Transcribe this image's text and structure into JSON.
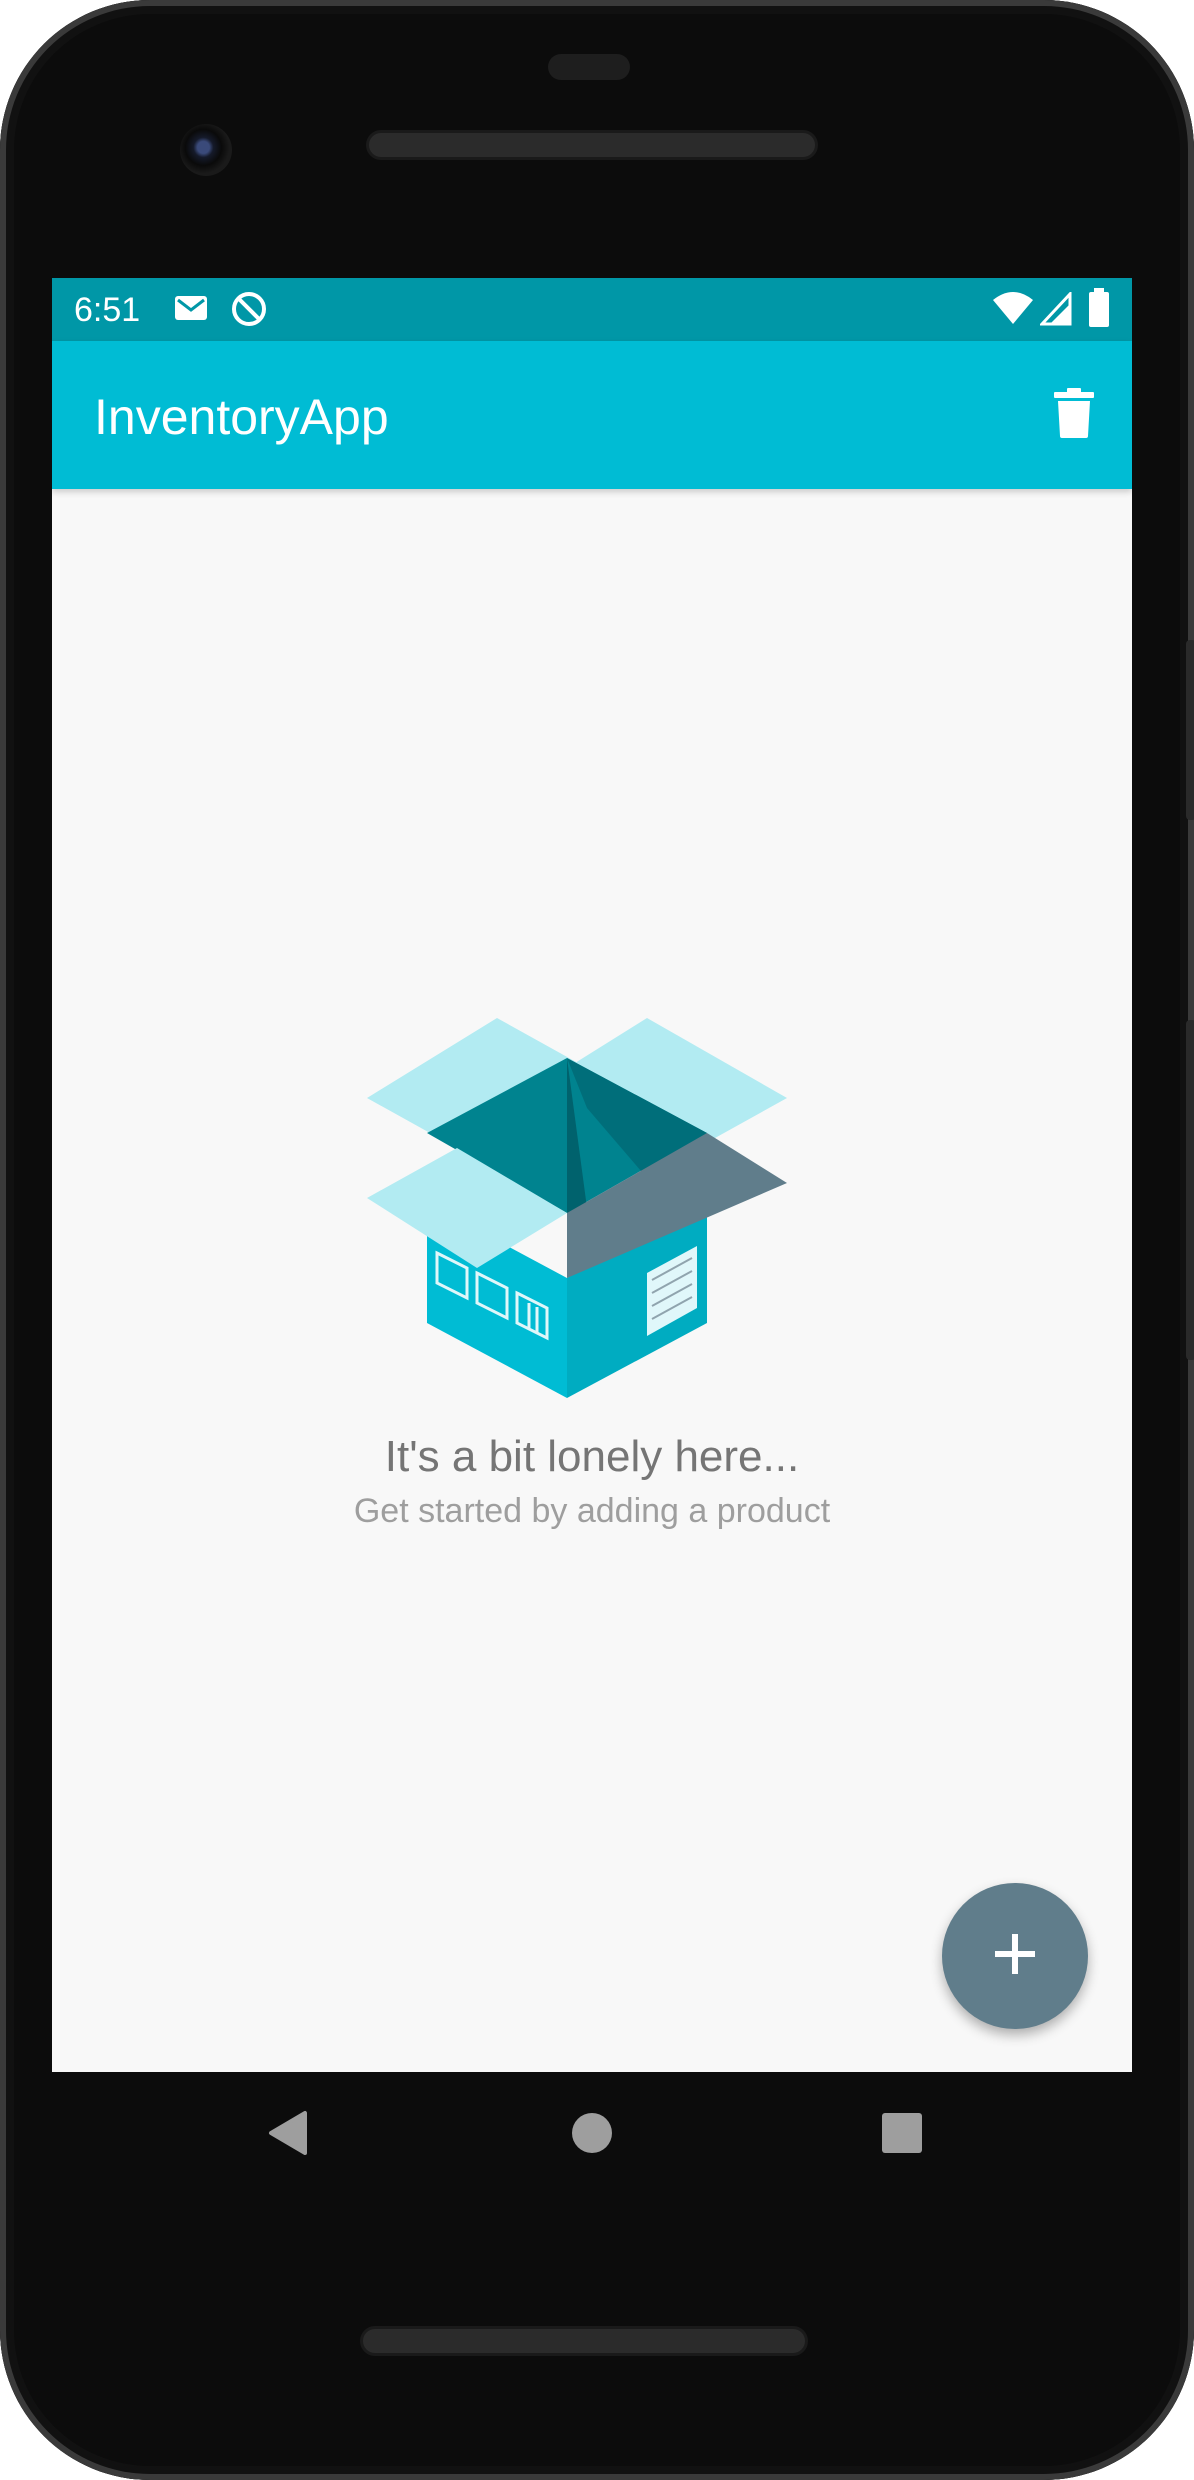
{
  "status_bar": {
    "time": "6:51",
    "left_icons": [
      "gmail-icon",
      "do-not-disturb-icon"
    ],
    "right_icons": [
      "wifi-icon",
      "cell-signal-icon",
      "battery-icon"
    ]
  },
  "app_bar": {
    "title": "InventoryApp",
    "action_icon": "delete-icon"
  },
  "empty_state": {
    "illustration": "open-box-icon",
    "title": "It's a bit lonely here...",
    "subtitle": "Get started by adding a product"
  },
  "fab": {
    "icon": "add-icon",
    "label": "+"
  },
  "nav_bar": {
    "buttons": [
      "back-icon",
      "home-icon",
      "recents-icon"
    ]
  },
  "colors": {
    "status_bar": "#0097a7",
    "app_bar": "#00bcd4",
    "background": "#f8f8f8",
    "fab": "#607d8b",
    "title_text": "#757575",
    "subtitle_text": "#9e9e9e"
  }
}
